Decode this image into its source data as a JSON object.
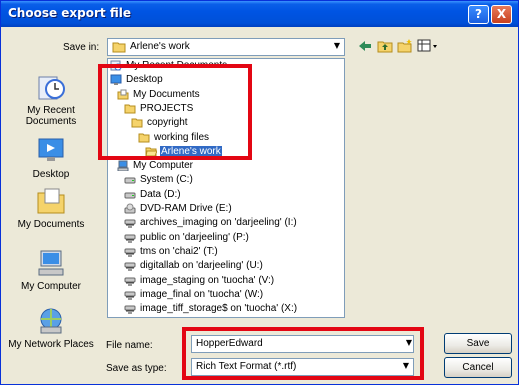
{
  "window": {
    "title": "Choose export file",
    "help_glyph": "?",
    "close_glyph": "X"
  },
  "save_in": {
    "label": "Save in:",
    "value": "Arlene's work"
  },
  "places": [
    {
      "label": "My Recent Documents",
      "icon": "recent-documents-icon"
    },
    {
      "label": "Desktop",
      "icon": "desktop-icon"
    },
    {
      "label": "My Documents",
      "icon": "my-documents-icon"
    },
    {
      "label": "My Computer",
      "icon": "my-computer-icon"
    },
    {
      "label": "My Network Places",
      "icon": "network-places-icon"
    }
  ],
  "dropdown": {
    "items": [
      {
        "label": "My Recent Documents",
        "icon": "recent-documents-icon",
        "indent": 0
      },
      {
        "label": "Desktop",
        "icon": "desktop-icon",
        "indent": 0
      },
      {
        "label": "My Documents",
        "icon": "my-documents-icon",
        "indent": 1
      },
      {
        "label": "PROJECTS",
        "icon": "folder-icon",
        "indent": 2
      },
      {
        "label": "copyright",
        "icon": "folder-icon",
        "indent": 3
      },
      {
        "label": "working files",
        "icon": "folder-icon",
        "indent": 4
      },
      {
        "label": "Arlene's work",
        "icon": "folder-open-icon",
        "indent": 5,
        "selected": true
      },
      {
        "label": "My Computer",
        "icon": "my-computer-icon",
        "indent": 1
      },
      {
        "label": "System (C:)",
        "icon": "drive-icon",
        "indent": 2
      },
      {
        "label": "Data (D:)",
        "icon": "drive-icon",
        "indent": 2
      },
      {
        "label": "DVD-RAM Drive (E:)",
        "icon": "dvd-drive-icon",
        "indent": 2
      },
      {
        "label": "archives_imaging on 'darjeeling' (I:)",
        "icon": "network-drive-icon",
        "indent": 2
      },
      {
        "label": "public on 'darjeeling' (P:)",
        "icon": "network-drive-icon",
        "indent": 2
      },
      {
        "label": "tms on 'chai2' (T:)",
        "icon": "network-drive-icon",
        "indent": 2
      },
      {
        "label": "digitallab on 'darjeeling' (U:)",
        "icon": "network-drive-icon",
        "indent": 2
      },
      {
        "label": "image_staging on 'tuocha' (V:)",
        "icon": "network-drive-icon",
        "indent": 2
      },
      {
        "label": "image_final on 'tuocha' (W:)",
        "icon": "network-drive-icon",
        "indent": 2
      },
      {
        "label": "image_tiff_storage$ on 'tuocha' (X:)",
        "icon": "network-drive-icon",
        "indent": 2
      }
    ]
  },
  "file_name": {
    "label": "File name:",
    "value": "HopperEdward"
  },
  "save_as_type": {
    "label": "Save as type:",
    "value": "Rich Text Format (*.rtf)"
  },
  "buttons": {
    "save": "Save",
    "cancel": "Cancel"
  },
  "colors": {
    "highlight": "#e30613",
    "selection": "#316ac5",
    "titlebar": "#0054e3"
  }
}
